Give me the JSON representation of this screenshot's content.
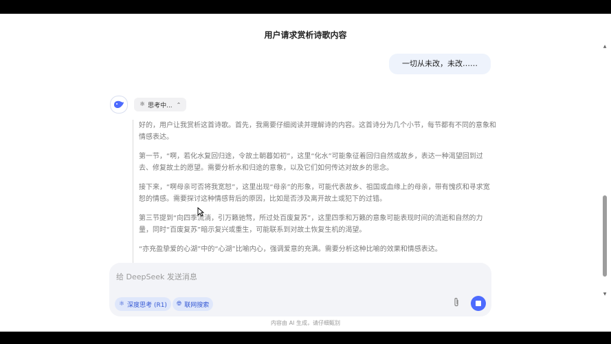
{
  "header": {
    "title": "用户请求赏析诗歌内容"
  },
  "conversation": {
    "user_message": "一切从未改，未改……",
    "assistant": {
      "avatar_icon": "whale-icon",
      "thinking_status": "思考中...",
      "thinking_icon": "atom-icon",
      "reasoning": [
        "好的，用户让我赏析这首诗歌。首先，我需要仔细阅读并理解诗的内容。这首诗分为几个小节，每节都有不同的意象和情感表达。",
        "第一节，“啊，若化水复回归途，令故土朝暮如初”，这里“化水”可能象征着回归自然或故乡，表达一种渴望回到过去、修复故土的愿望。需要分析水和归途的意象，以及它们如何传达对故乡的思念。",
        "接下来，“啊母亲可否将我宽恕”，这里出现“母亲”的形象，可能代表故乡、祖国或血缘上的母亲，带有愧疚和寻求宽恕的情感。需要探讨这种情感背后的原因，比如是否涉及离开故土或犯下的过错。",
        "第三节提到“向四季流淌，引万籁驰骛，所过处百废复苏”，这里四季和万籁的意象可能表现时间的流逝和自然的力量，同时“百废复苏”暗示复兴或重生，可能联系到对故土恢复生机的渴望。",
        "“亦充盈挚爱的心湖”中的“心湖”比喻内心，强调爱意的充满。需要分析这种比喻的效果和情感表达。"
      ]
    }
  },
  "composer": {
    "placeholder": "给 DeepSeek 发送消息",
    "deep_think_label": "深度思考 (R1)",
    "deep_think_icon": "atom-icon",
    "web_search_label": "联网搜索",
    "web_search_icon": "globe-icon",
    "attach_icon": "paperclip-icon",
    "send_icon": "stop-icon"
  },
  "footer": {
    "note": "内容由 AI 生成，请仔细甄别"
  },
  "colors": {
    "accent": "#4d6bfe",
    "chip_bg": "#dfe7fb",
    "user_bubble": "#eef3fc"
  }
}
